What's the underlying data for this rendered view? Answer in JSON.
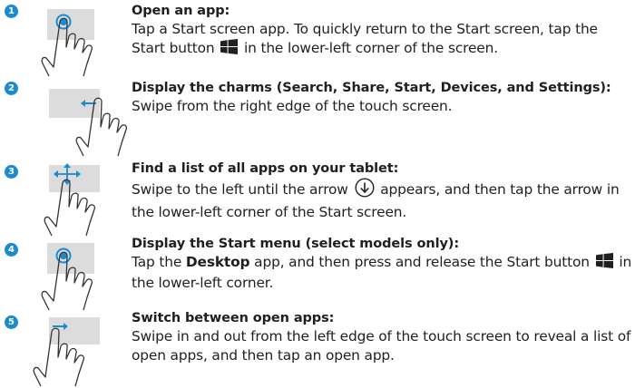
{
  "colors": {
    "accent": "#1a8bd0",
    "screen": "#dcdcdc",
    "hand_stroke": "#333333",
    "text": "#1f1f1f"
  },
  "steps": [
    {
      "number": "1",
      "gesture": "tap",
      "title": "Open an app:",
      "desc_part1": "Tap a Start screen app. To quickly return to the Start screen, tap the Start button",
      "desc_icon": "windows-logo-icon",
      "desc_part2": "in the lower-left corner of the screen."
    },
    {
      "number": "2",
      "gesture": "swipe-from-right",
      "title": "Display the charms (Search, Share, Start, Devices, and Settings):",
      "desc": "Swipe from the right edge of the touch screen."
    },
    {
      "number": "3",
      "gesture": "swipe-left",
      "title": "Find a list of all apps on your tablet:",
      "desc_part1": "Swipe to the left until the arrow",
      "desc_icon": "down-arrow-circle-icon",
      "desc_part2": "appears, and then tap the arrow in the lower-left corner of the Start screen."
    },
    {
      "number": "4",
      "gesture": "tap",
      "title": "Display the Start menu (select models only):",
      "desc_part1": "Tap the",
      "desc_bold": "Desktop",
      "desc_part2": "app, and then press and release the Start button",
      "desc_icon": "windows-logo-icon",
      "desc_part3": "in the lower-left corner."
    },
    {
      "number": "5",
      "gesture": "swipe-from-left",
      "title": "Switch between open apps:",
      "desc": "Swipe in and out from the left edge of the touch screen to reveal a list of open apps, and then tap an open app."
    }
  ]
}
